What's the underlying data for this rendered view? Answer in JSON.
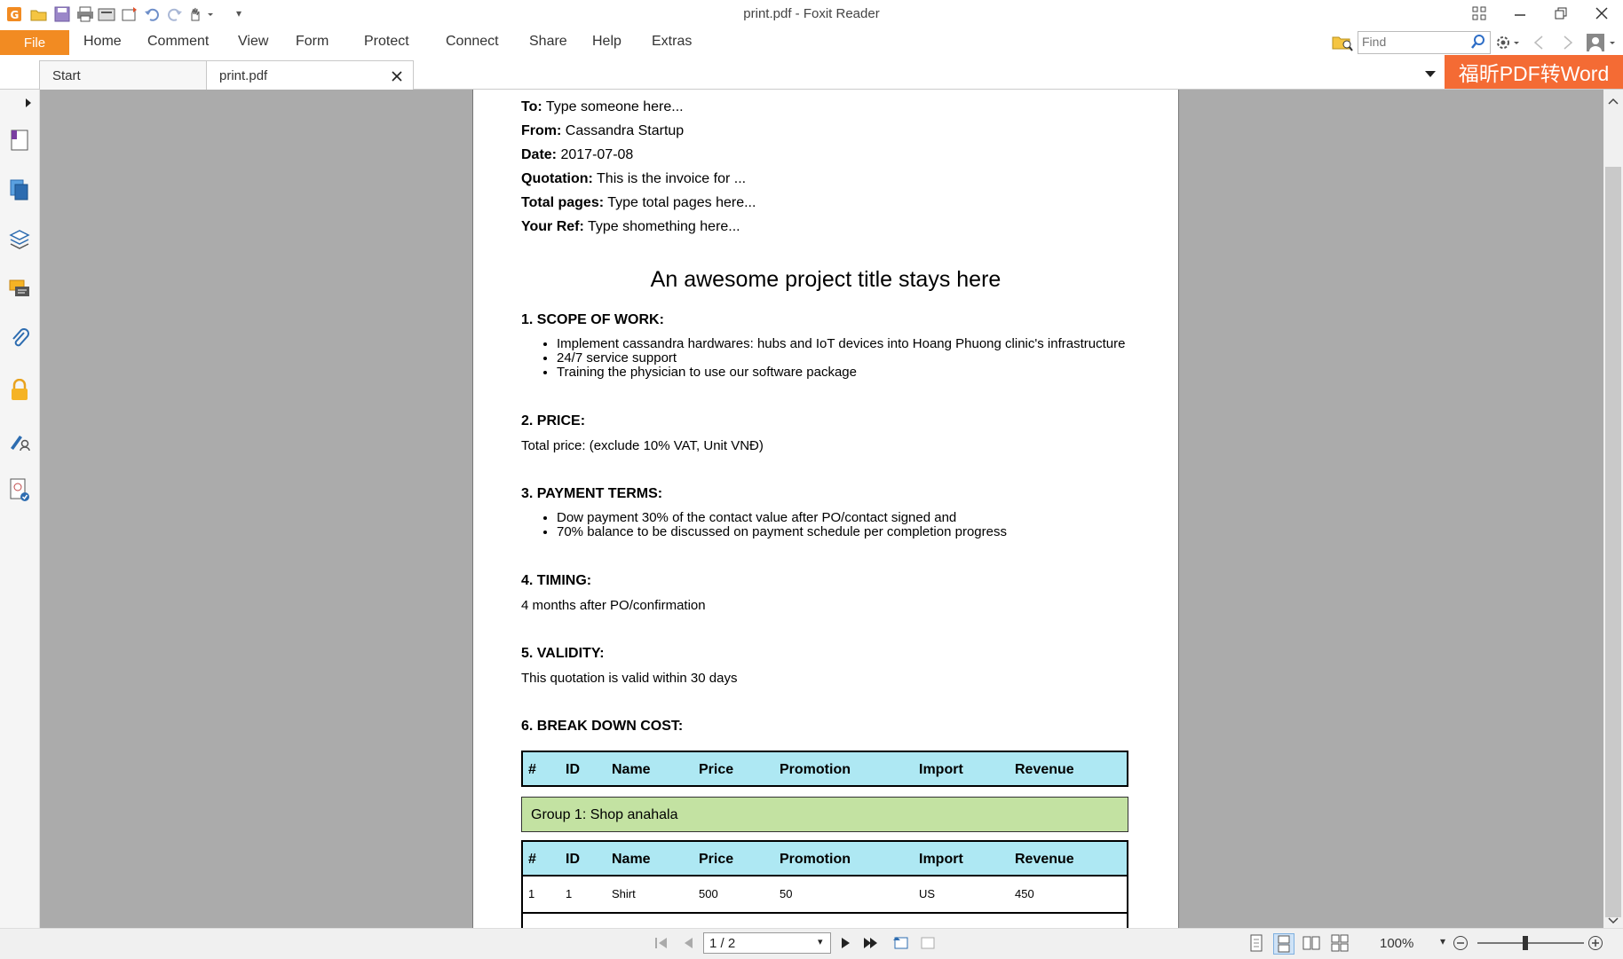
{
  "window": {
    "title": "print.pdf - Foxit Reader",
    "icons": [
      "app-logo-icon",
      "open-icon",
      "save-icon",
      "print-icon",
      "scan-icon",
      "snapshot-icon",
      "undo-icon",
      "redo-icon",
      "hand-tool-icon"
    ]
  },
  "menu": {
    "file": "File",
    "items": [
      "Home",
      "Comment",
      "View",
      "Form",
      "Protect",
      "Connect",
      "Share",
      "Help",
      "Extras"
    ],
    "find_placeholder": "Find"
  },
  "tabs": [
    {
      "label": "Start"
    },
    {
      "label": "print.pdf"
    }
  ],
  "promo": "福昕PDF转Word",
  "left_nav_icons": [
    "bookmark-icon",
    "pages-icon",
    "layers-icon",
    "comments-icon",
    "attachments-icon",
    "security-icon",
    "signature-icon",
    "certificate-icon"
  ],
  "doc": {
    "header_fields": [
      {
        "label": "To:",
        "value": "Type someone here..."
      },
      {
        "label": "From:",
        "value": "Cassandra Startup"
      },
      {
        "label": "Date:",
        "value": "2017-07-08"
      },
      {
        "label": "Quotation:",
        "value": "This is the invoice for ..."
      },
      {
        "label": "Total pages:",
        "value": "Type total pages here..."
      },
      {
        "label": "Your Ref:",
        "value": "Type shomething here..."
      }
    ],
    "project_title": "An awesome project title stays here",
    "scope": {
      "heading": "1. SCOPE OF WORK:",
      "bullets": [
        "Implement cassandra hardwares: hubs and IoT devices into Hoang Phuong clinic's infrastructure",
        "24/7 service support",
        "Training the physician to use our software package"
      ]
    },
    "price": {
      "heading": "2. PRICE:",
      "text": "Total price: (exclude 10% VAT, Unit VNĐ)"
    },
    "payment": {
      "heading": "3. PAYMENT TERMS:",
      "bullets": [
        "Dow payment 30% of the contact value after PO/contact signed and",
        "70% balance to be discussed on payment schedule per completion progress"
      ]
    },
    "timing": {
      "heading": "4. TIMING:",
      "text": "4 months after PO/confirmation"
    },
    "validity": {
      "heading": "5. VALIDITY:",
      "text": "This quotation is valid within 30 days"
    },
    "breakdown": {
      "heading": "6. BREAK DOWN COST:",
      "columns": [
        "#",
        "ID",
        "Name",
        "Price",
        "Promotion",
        "Import",
        "Revenue"
      ],
      "group_label": "Group 1: Shop anahala",
      "rows": [
        [
          "1",
          "1",
          "Shirt",
          "500",
          "50",
          "US",
          "450"
        ]
      ]
    }
  },
  "status": {
    "page_indicator": "1 / 2",
    "zoom": "100%",
    "zoom_slider_fraction": 0.45
  },
  "colors": {
    "file_button": "#f28b22",
    "promo": "#f46b34",
    "table_header": "#aee8f3",
    "group_row": "#c3e2a2",
    "doc_background": "#ababab"
  }
}
